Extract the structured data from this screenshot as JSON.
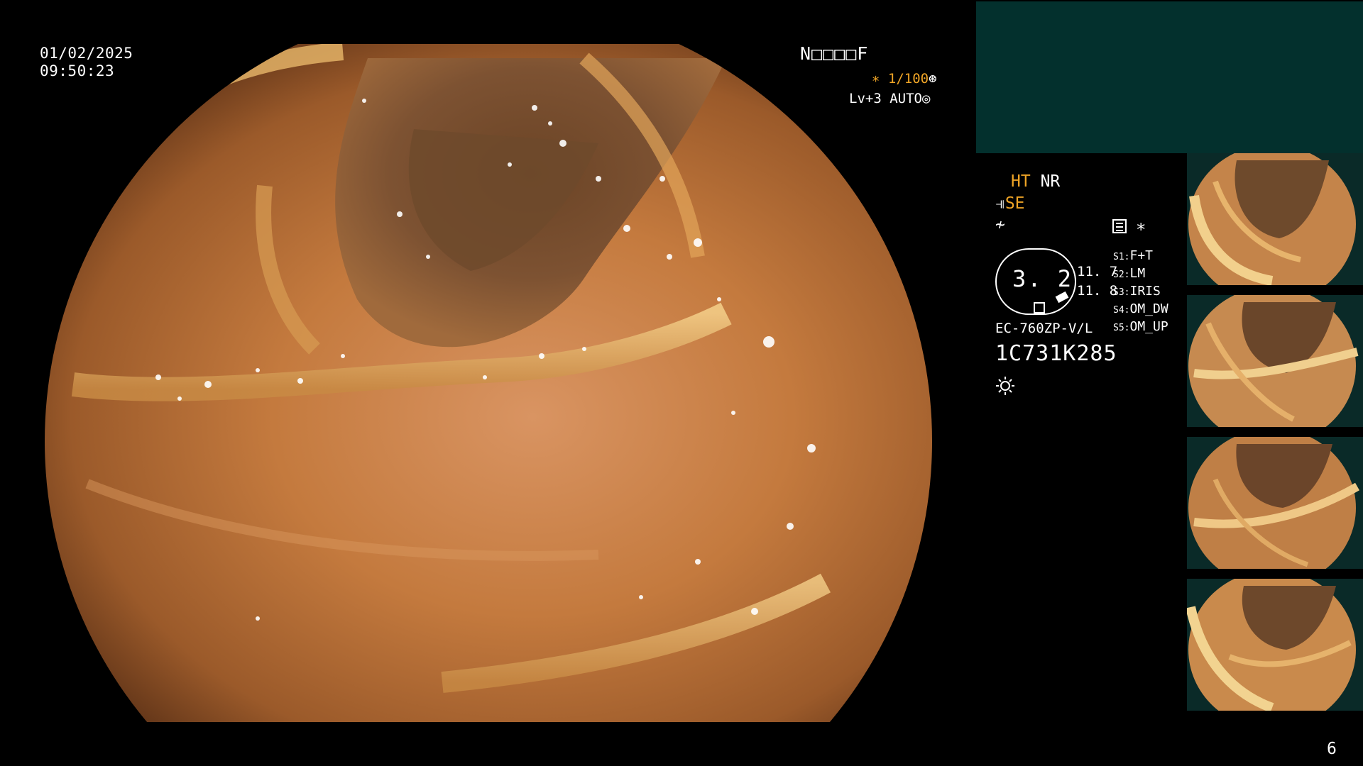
{
  "overlay": {
    "date": "01/02/2025",
    "time": "09:50:23",
    "patient_id": "N□□□□F",
    "shutter": "∗ 1/100",
    "shutter_icon": "⊛",
    "level": "Lv+3 AUTO",
    "level_icon": "◎"
  },
  "side_panel": {
    "ht": "HT",
    "nr": "NR",
    "se_icon": "⫣",
    "se": "SE",
    "flash_icon": "≁",
    "zoom_value": "3. 2",
    "zoom_right_a": "11. 7",
    "zoom_right_b": "11. 8",
    "scope_model": "EC-760ZP-V/L",
    "serial": "1C731K285",
    "asterisk": "∗",
    "presets": [
      {
        "key": "S1:",
        "value": "F+T"
      },
      {
        "key": "S2:",
        "value": "LM"
      },
      {
        "key": "S3:",
        "value": "IRIS"
      },
      {
        "key": "S4:",
        "value": "OM_DW"
      },
      {
        "key": "S5:",
        "value": "OM_UP"
      }
    ]
  },
  "colors": {
    "accent_orange": "#f0a526",
    "panel_teal": "#03302d",
    "mucosa": "#c47a3e"
  },
  "thumbnails": [
    "capture-1",
    "capture-2",
    "capture-3",
    "capture-4"
  ],
  "page_number": "6"
}
